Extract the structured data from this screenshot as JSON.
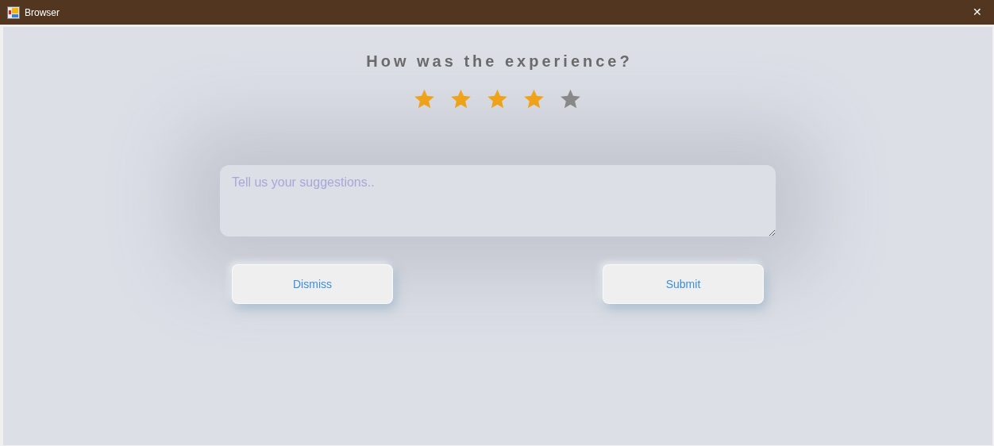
{
  "window": {
    "title": "Browser",
    "close": "✕"
  },
  "heading": "How was the experience?",
  "rating": {
    "stars": 4
  },
  "suggestions": {
    "placeholder": "Tell us your suggestions.."
  },
  "buttons": [
    "Dismiss",
    "Submit"
  ]
}
